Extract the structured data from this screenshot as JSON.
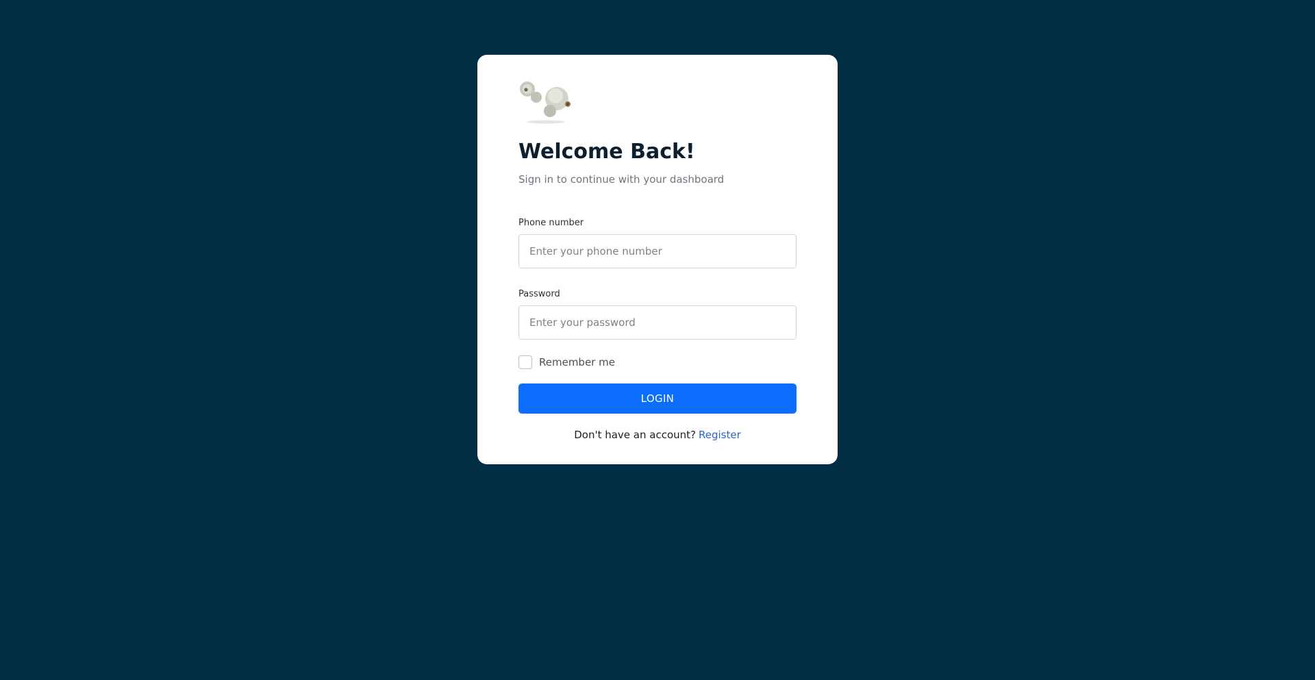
{
  "card": {
    "logo_icon": "earbuds-logo-icon",
    "title": "Welcome Back!",
    "subtitle": "Sign in to continue with your dashboard"
  },
  "form": {
    "phone": {
      "label": "Phone number",
      "value": "",
      "placeholder": "Enter your phone number"
    },
    "password": {
      "label": "Password",
      "value": "",
      "placeholder": "Enter your password"
    },
    "remember": {
      "label": "Remember me",
      "checked": false
    },
    "login_label": "LOGIN"
  },
  "footer": {
    "prompt": "Don't have an account?",
    "register_label": "Register"
  },
  "colors": {
    "background": "#012d45",
    "primary": "#0d6efd",
    "link": "#2a66c8"
  }
}
